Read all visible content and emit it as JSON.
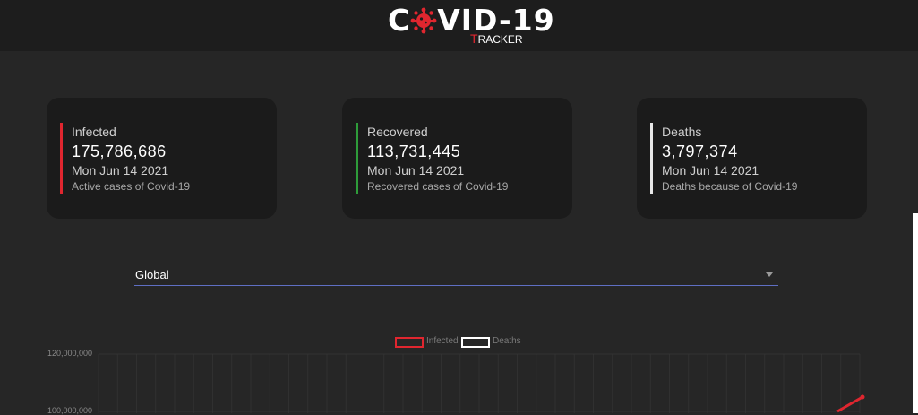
{
  "header": {
    "logo_text_prefix": "C",
    "logo_text_suffix": "VID-19",
    "logo_sub_first": "T",
    "logo_sub_rest": "RACKER",
    "logo_accent": "#e0262f",
    "logo_icon": "virus-icon"
  },
  "cards": [
    {
      "label": "Infected",
      "value": "175,786,686",
      "date": "Mon Jun 14 2021",
      "description": "Active cases of Covid-19",
      "color": "#e0262f"
    },
    {
      "label": "Recovered",
      "value": "113,731,445",
      "date": "Mon Jun 14 2021",
      "description": "Recovered cases of Covid-19",
      "color": "#2e9c3a"
    },
    {
      "label": "Deaths",
      "value": "3,797,374",
      "date": "Mon Jun 14 2021",
      "description": "Deaths because of Covid-19",
      "color": "#e8e8e8"
    }
  ],
  "country_select": {
    "selected": "Global",
    "icon": "chevron-down-icon"
  },
  "chart_data": {
    "type": "line",
    "legend": [
      "Infected",
      "Deaths"
    ],
    "series": [
      {
        "name": "Infected",
        "color": "#e0262f",
        "values": [
          100000000,
          105000000
        ]
      },
      {
        "name": "Deaths",
        "color": "#ffffff",
        "values": []
      }
    ],
    "y_ticks": [
      "120,000,000",
      "100,000,000"
    ],
    "ylim": [
      100000000,
      120000000
    ],
    "grid": true
  }
}
